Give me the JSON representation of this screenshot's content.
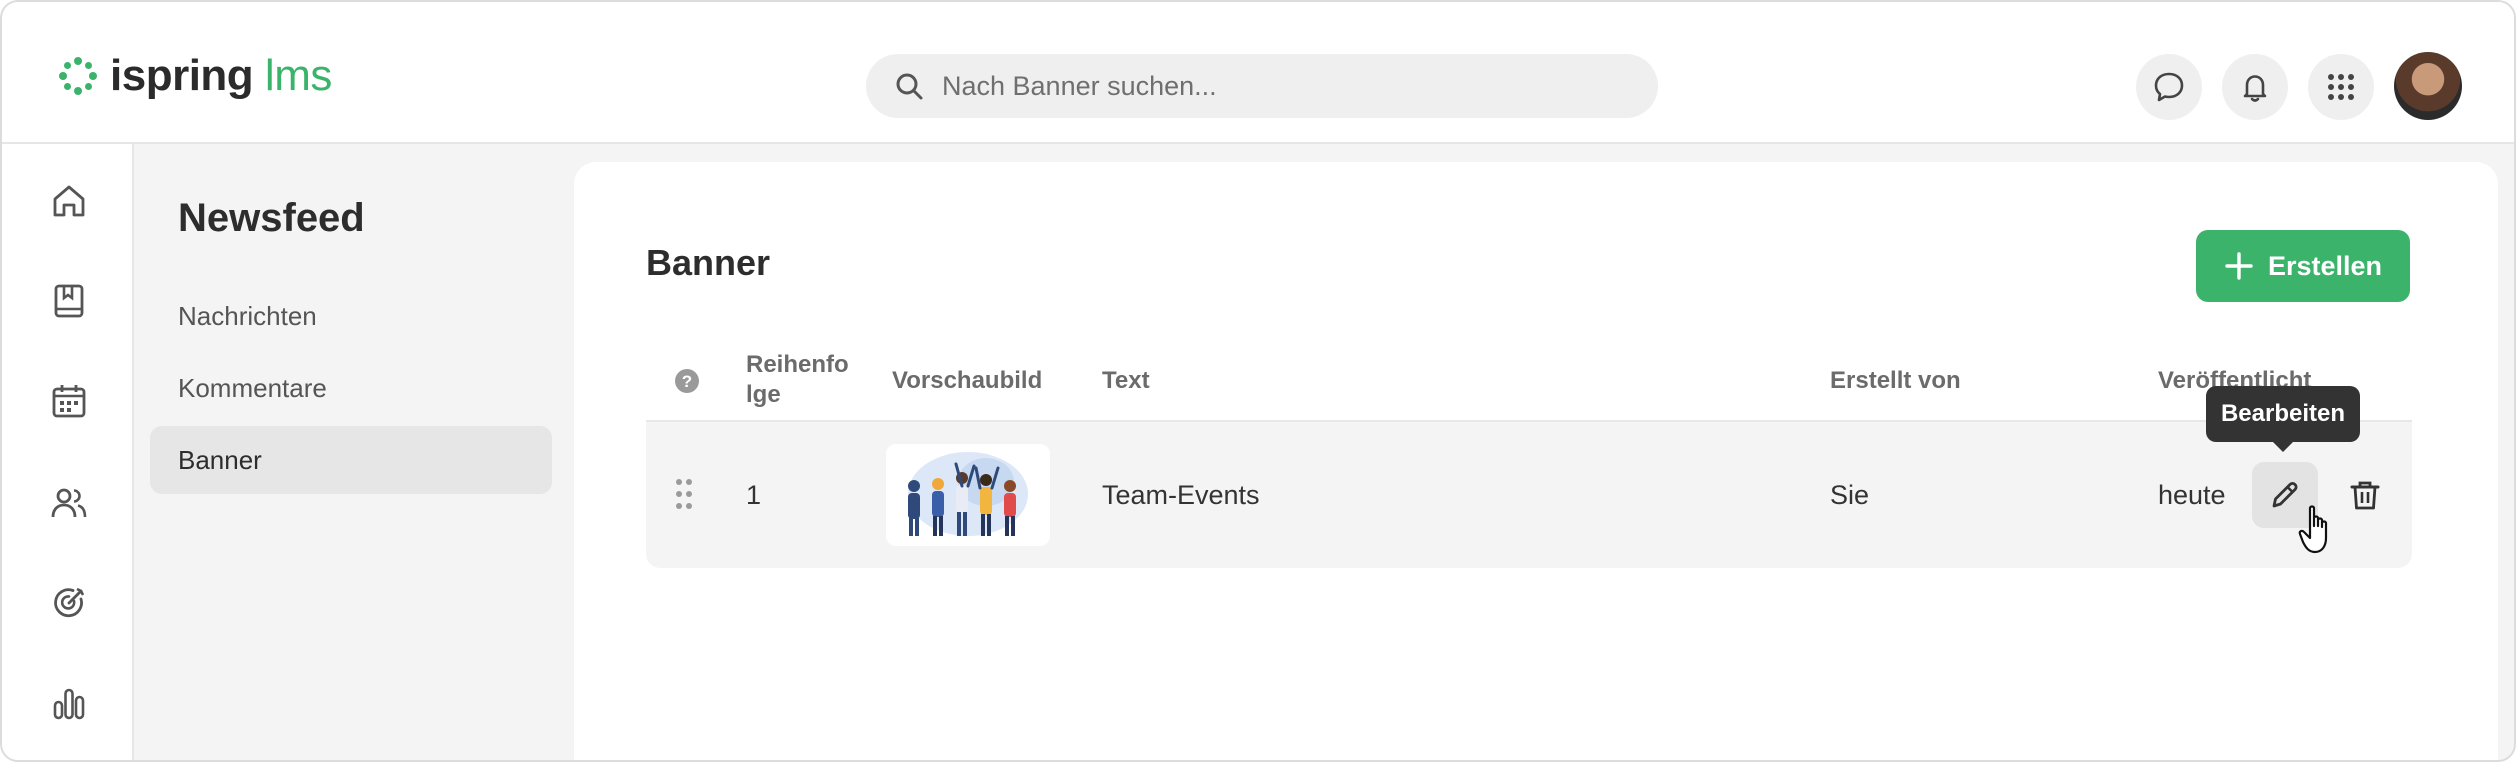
{
  "header": {
    "logo_main": "ispring",
    "logo_accent": "lms",
    "search_placeholder": "Nach Banner suchen...",
    "buttons": [
      "chat-icon",
      "bell-icon",
      "apps-grid-icon"
    ]
  },
  "rail": {
    "items": [
      "home-icon",
      "book-icon",
      "calendar-icon",
      "users-icon",
      "target-icon",
      "stats-icon"
    ]
  },
  "section_nav": {
    "title": "Newsfeed",
    "items": [
      {
        "label": "Nachrichten",
        "active": false
      },
      {
        "label": "Kommentare",
        "active": false
      },
      {
        "label": "Banner",
        "active": true
      }
    ]
  },
  "main": {
    "title": "Banner",
    "create_label": "Erstellen",
    "columns": {
      "help": "?",
      "order_line1": "Reihenfo",
      "order_line2": "lge",
      "preview": "Vorschaubild",
      "text": "Text",
      "created_by": "Erstellt von",
      "published": "Veröffentlicht"
    },
    "rows": [
      {
        "order": "1",
        "text": "Team-Events",
        "created_by": "Sie",
        "published": "heute"
      }
    ],
    "tooltip": "Bearbeiten"
  },
  "colors": {
    "accent": "#3bb36b",
    "tooltip_bg": "#333333"
  }
}
